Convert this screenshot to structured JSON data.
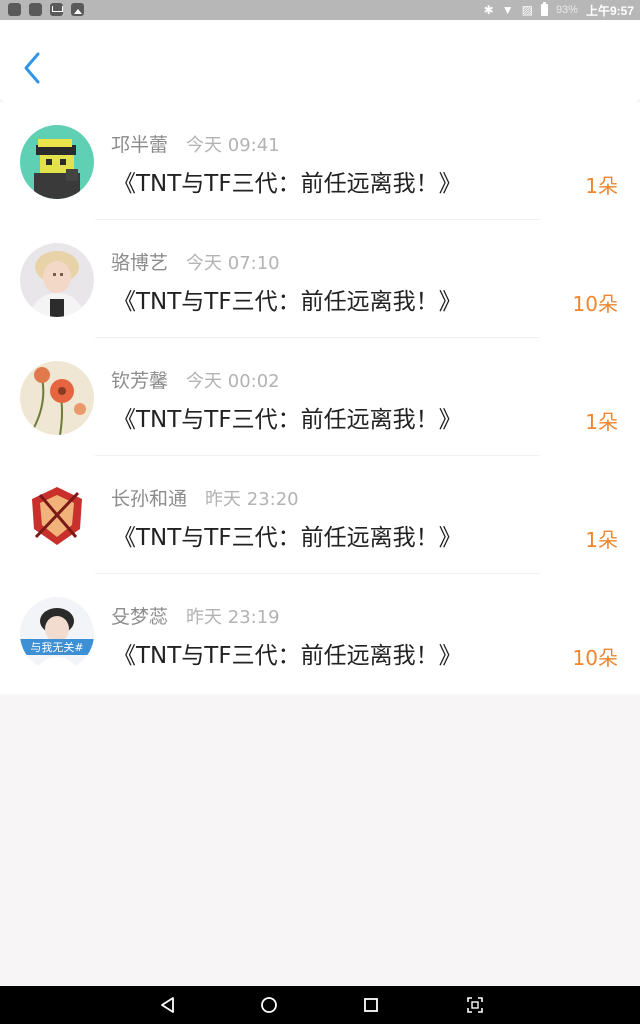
{
  "status_bar": {
    "battery_percent": "93%",
    "time": "上午9:57",
    "icons": [
      "app-icon",
      "app-icon",
      "mail-icon",
      "image-icon",
      "bluetooth-icon",
      "wifi-icon",
      "no-sim-icon",
      "battery-icon"
    ]
  },
  "header": {
    "back_icon": "chevron-left-icon",
    "accent_color": "#2f95e8"
  },
  "gifts": [
    {
      "name": "邛半蕾",
      "time": "今天 09:41",
      "title": "《TNT与TF三代：前任远离我！》",
      "flowers": "1朵",
      "avatar": "pixel-character-avatar"
    },
    {
      "name": "骆博艺",
      "time": "今天 07:10",
      "title": "《TNT与TF三代：前任远离我！》",
      "flowers": "10朵",
      "avatar": "blonde-boy-avatar"
    },
    {
      "name": "钦芳馨",
      "time": "今天 00:02",
      "title": "《TNT与TF三代：前任远离我！》",
      "flowers": "1朵",
      "avatar": "flowers-avatar"
    },
    {
      "name": "长孙和通",
      "time": "昨天 23:20",
      "title": "《TNT与TF三代：前任远离我！》",
      "flowers": "1朵",
      "avatar": "anime-badge-avatar"
    },
    {
      "name": "殳梦蕊",
      "time": "昨天 23:19",
      "title": "《TNT与TF三代：前任远离我！》",
      "flowers": "10朵",
      "avatar": "boy-banner-avatar",
      "avatar_text": "与我无关#"
    }
  ],
  "colors": {
    "flowers": "#f0852d",
    "name": "#8c8c8c",
    "time": "#b3b3b3",
    "title": "#222222",
    "background": "#f7f5f5"
  },
  "nav_bar": {
    "icons": [
      "back-triangle-icon",
      "home-circle-icon",
      "recents-square-icon",
      "screenshot-icon"
    ]
  }
}
